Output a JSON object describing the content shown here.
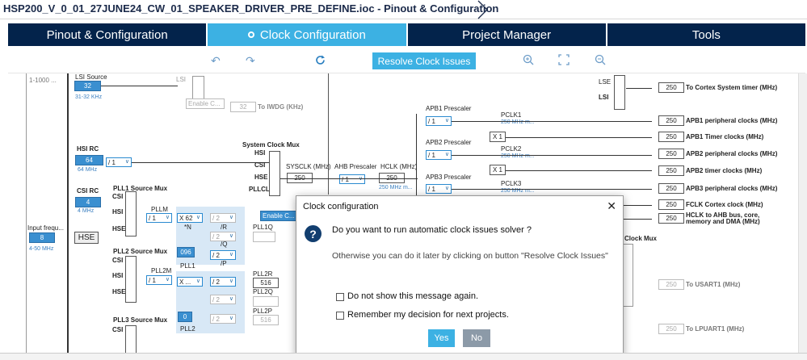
{
  "window": {
    "title": "HSP200_V_0_01_27JUNE24_CW_01_SPEAKER_DRIVER_PRE_DEFINE.ioc - Pinout & Configuration"
  },
  "tabs": [
    {
      "label": "Pinout & Configuration",
      "active": false
    },
    {
      "label": "Clock Configuration",
      "active": true
    },
    {
      "label": "Project Manager",
      "active": false
    },
    {
      "label": "Tools",
      "active": false
    }
  ],
  "toolbar": {
    "undo_icon": "undo-icon",
    "redo_icon": "redo-icon",
    "refresh_icon": "refresh-icon",
    "resolve_label": "Resolve Clock Issues",
    "zoom_in_icon": "zoom-in-icon",
    "fit_icon": "fit-to-screen-icon",
    "zoom_out_icon": "zoom-out-icon"
  },
  "diagram": {
    "range_top": "1-1000 ...",
    "lsi_source": "LSI Source",
    "lsi_value": "32",
    "lsi_range": "31-32 KHz",
    "lsi_mux_label": "LSI",
    "enable_css_1": "Enable C...",
    "iwdg_value": "32",
    "iwdg_label": "To IWDG (KHz)",
    "hsi_rc": "HSI RC",
    "hsi_value": "64",
    "hsi_freq": "64 MHz",
    "hsi_div": "/ 1",
    "system_clock_mux": "System Clock Mux",
    "sysmux_inputs": [
      "HSI",
      "CSI",
      "HSE",
      "PLLCLK"
    ],
    "sysclk_label": "SYSCLK (MHz)",
    "sysclk_value": "250",
    "ahb_prescaler": "AHB Prescaler",
    "ahb_value": "/ 1",
    "hclk_label": "HCLK (MHz)",
    "hclk_value": "250",
    "hclk_sub": "250 MHz m...",
    "csi_rc": "CSI RC",
    "csi_value": "4",
    "csi_freq": "4 MHz",
    "pll1_source_mux": "PLL1 Source Mux",
    "pll1_inputs": [
      "CSI",
      "HSI",
      "HSE"
    ],
    "pllm_label": "PLLM",
    "pllm_value": "/ 1",
    "mult_value": "X 62",
    "n_label": "*N",
    "r_label": "/R",
    "q_label": "/Q",
    "p_label": "/P",
    "div_r": "/ 2",
    "div_q": "/ 2",
    "div_p": "/ 2",
    "pll1_frac": "096",
    "pll1_name": "PLL1",
    "pll1q_label": "PLL1Q",
    "enable_css_2": "Enable C...",
    "input_freq_label": "Input frequ...",
    "input_freq_value": "8",
    "input_range": "4-50 MHz",
    "hse_label": "HSE",
    "pll2_source_mux": "PLL2 Source Mux",
    "pll2_inputs": [
      "CSI",
      "HSI",
      "HSE"
    ],
    "pll2m_label": "PLL2M",
    "pll2m_value": "/ 1",
    "pll2_mult": "X ...",
    "pll2_div_r": "/ 2",
    "pll2_div_q": "/ 2",
    "pll2_div_p": "/ 2",
    "pll2_frac": "0",
    "pll2_name": "PLL2",
    "pll2r_label": "PLL2R",
    "pll2r_value": "516",
    "pll2q_label": "PLL2Q",
    "pll2p_label": "PLL2P",
    "pll2p_value": "516",
    "pll3_source_mux": "PLL3 Source Mux",
    "pll3_inputs": [
      "CSI"
    ],
    "apb1_prescaler": "APB1 Prescaler",
    "apb1_value": "/ 1",
    "pclk1": "PCLK1",
    "pclk1_sub": "250 MHz m...",
    "apb2_prescaler": "APB2 Prescaler",
    "apb2_value": "/ 1",
    "pclk2": "PCLK2",
    "pclk2_sub": "250 MHz m...",
    "apb3_prescaler": "APB3 Prescaler",
    "apb3_value": "/ 1",
    "pclk3": "PCLK3",
    "pclk3_sub": "250 MHz m...",
    "x1_a": "X 1",
    "x1_b": "X 1",
    "lse_label": "LSE",
    "lsi_label2": "LSI",
    "clock_mux": "Clock Mux",
    "outputs": [
      {
        "value": "250",
        "label": "To Cortex System timer (MHz)"
      },
      {
        "value": "250",
        "label": "APB1 peripheral clocks (MHz)"
      },
      {
        "value": "250",
        "label": "APB1 Timer clocks (MHz)"
      },
      {
        "value": "250",
        "label": "APB2 peripheral clocks (MHz)"
      },
      {
        "value": "250",
        "label": "APB2 timer clocks (MHz)"
      },
      {
        "value": "250",
        "label": "APB3 peripheral clocks (MHz)"
      },
      {
        "value": "250",
        "label": "FCLK Cortex clock (MHz)"
      },
      {
        "value": "250",
        "label": "HCLK to AHB bus, core, memory and DMA (MHz)"
      }
    ],
    "usart1_value": "250",
    "usart1_label": "To USART1 (MHz)",
    "lpuart1_value": "250",
    "lpuart1_label": "To LPUART1 (MHz)"
  },
  "dialog": {
    "title": "Clock configuration",
    "close_icon": "close-icon",
    "question_icon": "question-icon",
    "message": "Do you want to run automatic clock issues solver ?",
    "submessage": "Otherwise you can do it later by clicking on button \"Resolve Clock Issues\"",
    "checkbox1": "Do not show this message again.",
    "checkbox2": "Remember my decision for next projects.",
    "yes": "Yes",
    "no": "No"
  },
  "colors": {
    "tab_bg": "#03234b",
    "tab_active": "#3cb1e3",
    "accent": "#3cb1e3",
    "no_button": "#8c9aa8"
  }
}
